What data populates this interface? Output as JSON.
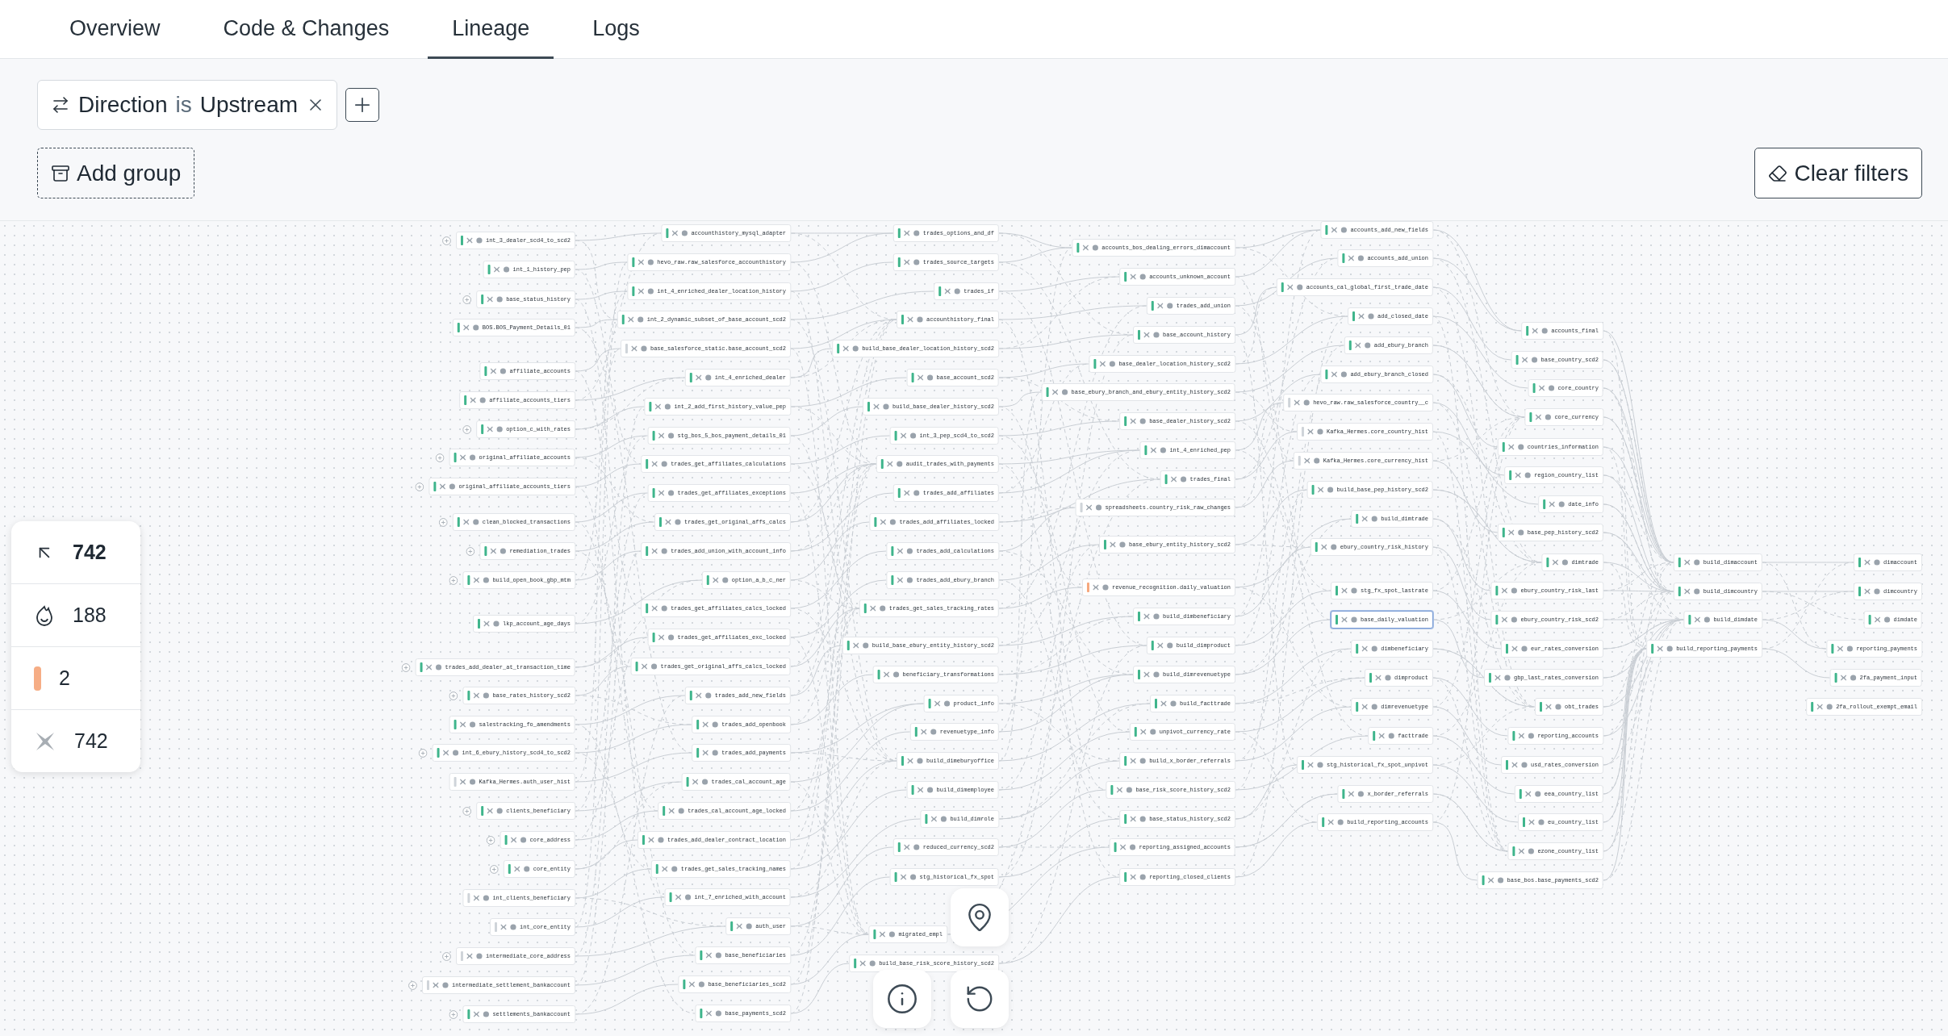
{
  "tabs": [
    {
      "label": "Overview",
      "selected": false
    },
    {
      "label": "Code & Changes",
      "selected": false
    },
    {
      "label": "Lineage",
      "selected": true
    },
    {
      "label": "Logs",
      "selected": false
    }
  ],
  "filters": [
    {
      "field": "Direction",
      "operator": "is",
      "value": "Upstream"
    }
  ],
  "add_group_button": "Add group",
  "clear_filters_button": "Clear filters",
  "stats": [
    {
      "kind": "upstream",
      "value": "742"
    },
    {
      "kind": "models",
      "value": "188"
    },
    {
      "kind": "warnings",
      "value": "2"
    },
    {
      "kind": "tests",
      "value": "742"
    }
  ],
  "lineage": {
    "columns": [
      [
        {
          "label": "int_3_dealer_scd4_to_scd2",
          "expandable": true,
          "color": "#3fb58c",
          "selected": false
        },
        {
          "label": "int_1_history_pep",
          "expandable": false,
          "color": "#3fb58c",
          "selected": false
        },
        {
          "label": "base_status_history",
          "expandable": true,
          "color": "#3fb58c",
          "selected": false
        },
        {
          "label": "BOS.BOS_Payment_Details_01",
          "expandable": false,
          "color": "#3fb58c",
          "selected": false
        },
        {
          "label": "affiliate_accounts",
          "expandable": false,
          "color": "#3fb58c",
          "selected": false
        },
        {
          "label": "affiliate_accounts_tiers",
          "expandable": false,
          "color": "#3fb58c",
          "selected": false
        },
        {
          "label": "option_c_with_rates",
          "expandable": true,
          "color": "#3fb58c",
          "selected": false
        },
        {
          "label": "original_affiliate_accounts",
          "expandable": true,
          "color": "#3fb58c",
          "selected": false
        },
        {
          "label": "original_affiliate_accounts_tiers",
          "expandable": true,
          "color": "#3fb58c",
          "selected": false
        },
        {
          "label": "clean_blocked_transactions",
          "expandable": true,
          "color": "#3fb58c",
          "selected": false
        },
        {
          "label": "remediation_trades",
          "expandable": true,
          "color": "#3fb58c",
          "selected": false
        },
        {
          "label": "build_open_book_gbp_mtm",
          "expandable": true,
          "color": "#3fb58c",
          "selected": false
        },
        {
          "label": "lkp_account_age_days",
          "expandable": false,
          "color": "#3fb58c",
          "selected": false
        },
        {
          "label": "trades_add_dealer_at_transaction_time",
          "expandable": true,
          "color": "#3fb58c",
          "selected": false
        },
        {
          "label": "base_rates_history_scd2",
          "expandable": true,
          "color": "#3fb58c",
          "selected": false
        },
        {
          "label": "salestracking_fo_amendments",
          "expandable": false,
          "color": "#3fb58c",
          "selected": false
        },
        {
          "label": "int_6_ebury_history_scd4_to_scd2",
          "expandable": true,
          "color": "#3fb58c",
          "selected": false
        },
        {
          "label": "Kafka_Hermes.auth_user_hist",
          "expandable": false,
          "color": "#cfd4d9",
          "selected": false
        },
        {
          "label": "clients_beneficiary",
          "expandable": true,
          "color": "#3fb58c",
          "selected": false
        },
        {
          "label": "core_address",
          "expandable": true,
          "color": "#3fb58c",
          "selected": false
        },
        {
          "label": "core_entity",
          "expandable": true,
          "color": "#3fb58c",
          "selected": false
        },
        {
          "label": "int_clients_beneficiary",
          "expandable": false,
          "color": "#cfd4d9",
          "selected": false
        },
        {
          "label": "int_core_entity",
          "expandable": false,
          "color": "#cfd4d9",
          "selected": false
        },
        {
          "label": "intermediate_core_address",
          "expandable": true,
          "color": "#cfd4d9",
          "selected": false
        },
        {
          "label": "intermediate_settlement_bankaccount",
          "expandable": true,
          "color": "#cfd4d9",
          "selected": false
        },
        {
          "label": "settlements_bankaccount",
          "expandable": true,
          "color": "#3fb58c",
          "selected": false
        }
      ],
      [
        {
          "label": "accounthistory_mysql_adapter",
          "expandable": false,
          "color": "#3fb58c",
          "selected": false
        },
        {
          "label": "hevo_raw.raw_salesforce_accounthistory",
          "expandable": false,
          "color": "#3fb58c",
          "selected": false
        },
        {
          "label": "int_4_enriched_dealer_location_history",
          "expandable": false,
          "color": "#3fb58c",
          "selected": false
        },
        {
          "label": "int_2_dynamic_subset_of_base_account_scd2",
          "expandable": false,
          "color": "#3fb58c",
          "selected": false
        },
        {
          "label": "base_salesforce_static.base_account_scd2",
          "expandable": false,
          "color": "#cfd4d9",
          "selected": false
        },
        {
          "label": "int_4_enriched_dealer",
          "expandable": false,
          "color": "#3fb58c",
          "selected": false
        },
        {
          "label": "int_2_add_first_history_value_pep",
          "expandable": false,
          "color": "#3fb58c",
          "selected": false
        },
        {
          "label": "stg_bos_5_bos_payment_details_01",
          "expandable": false,
          "color": "#3fb58c",
          "selected": false
        },
        {
          "label": "trades_get_affiliates_calculations",
          "expandable": false,
          "color": "#3fb58c",
          "selected": false
        },
        {
          "label": "trades_get_affiliates_exceptions",
          "expandable": false,
          "color": "#3fb58c",
          "selected": false
        },
        {
          "label": "trades_get_original_affs_calcs",
          "expandable": false,
          "color": "#3fb58c",
          "selected": false
        },
        {
          "label": "trades_add_union_with_account_info",
          "expandable": false,
          "color": "#3fb58c",
          "selected": false
        },
        {
          "label": "option_a_b_c_ner",
          "expandable": false,
          "color": "#3fb58c",
          "selected": false
        },
        {
          "label": "trades_get_affiliates_calcs_locked",
          "expandable": false,
          "color": "#3fb58c",
          "selected": false
        },
        {
          "label": "trades_get_affiliates_exc_locked",
          "expandable": false,
          "color": "#3fb58c",
          "selected": false
        },
        {
          "label": "trades_get_original_affs_calcs_locked",
          "expandable": false,
          "color": "#3fb58c",
          "selected": false
        },
        {
          "label": "trades_add_new_fields",
          "expandable": false,
          "color": "#3fb58c",
          "selected": false
        },
        {
          "label": "trades_add_openbook",
          "expandable": false,
          "color": "#3fb58c",
          "selected": false
        },
        {
          "label": "trades_add_payments",
          "expandable": false,
          "color": "#3fb58c",
          "selected": false
        },
        {
          "label": "trades_cal_account_age",
          "expandable": false,
          "color": "#3fb58c",
          "selected": false
        },
        {
          "label": "trades_cal_account_age_locked",
          "expandable": false,
          "color": "#3fb58c",
          "selected": false
        },
        {
          "label": "trades_add_dealer_contract_location",
          "expandable": false,
          "color": "#3fb58c",
          "selected": false
        },
        {
          "label": "trades_get_sales_tracking_names",
          "expandable": false,
          "color": "#3fb58c",
          "selected": false
        },
        {
          "label": "int_7_enriched_with_account",
          "expandable": false,
          "color": "#3fb58c",
          "selected": false
        },
        {
          "label": "auth_user",
          "expandable": false,
          "color": "#3fb58c",
          "selected": false
        },
        {
          "label": "base_beneficiaries",
          "expandable": false,
          "color": "#3fb58c",
          "selected": false
        },
        {
          "label": "base_beneficiaries_scd2",
          "expandable": false,
          "color": "#3fb58c",
          "selected": false
        },
        {
          "label": "base_payments_scd2",
          "expandable": false,
          "color": "#3fb58c",
          "selected": false
        }
      ],
      [
        {
          "label": "trades_options_and_df",
          "expandable": false,
          "color": "#3fb58c",
          "selected": false
        },
        {
          "label": "trades_source_targets",
          "expandable": false,
          "color": "#3fb58c",
          "selected": false
        },
        {
          "label": "trades_if",
          "expandable": false,
          "color": "#3fb58c",
          "selected": false
        },
        {
          "label": "accounthistory_final",
          "expandable": false,
          "color": "#3fb58c",
          "selected": false
        },
        {
          "label": "build_base_dealer_location_history_scd2",
          "expandable": false,
          "color": "#3fb58c",
          "selected": false
        },
        {
          "label": "base_account_scd2",
          "expandable": false,
          "color": "#3fb58c",
          "selected": false
        },
        {
          "label": "build_base_dealer_history_scd2",
          "expandable": false,
          "color": "#3fb58c",
          "selected": false
        },
        {
          "label": "int_3_pep_scd4_to_scd2",
          "expandable": false,
          "color": "#3fb58c",
          "selected": false
        },
        {
          "label": "audit_trades_with_payments",
          "expandable": false,
          "color": "#3fb58c",
          "selected": false
        },
        {
          "label": "trades_add_affiliates",
          "expandable": false,
          "color": "#3fb58c",
          "selected": false
        },
        {
          "label": "trades_add_affiliates_locked",
          "expandable": false,
          "color": "#3fb58c",
          "selected": false
        },
        {
          "label": "trades_add_calculations",
          "expandable": false,
          "color": "#3fb58c",
          "selected": false
        },
        {
          "label": "trades_add_ebury_branch",
          "expandable": false,
          "color": "#3fb58c",
          "selected": false
        },
        {
          "label": "trades_get_sales_tracking_rates",
          "expandable": false,
          "color": "#3fb58c",
          "selected": false
        },
        {
          "label": "build_base_ebury_entity_history_scd2",
          "expandable": false,
          "color": "#3fb58c",
          "selected": false
        },
        {
          "label": "beneficiary_transformations",
          "expandable": false,
          "color": "#3fb58c",
          "selected": false
        },
        {
          "label": "product_info",
          "expandable": false,
          "color": "#3fb58c",
          "selected": false
        },
        {
          "label": "revenuetype_info",
          "expandable": false,
          "color": "#3fb58c",
          "selected": false
        },
        {
          "label": "build_dimeburyoffice",
          "expandable": false,
          "color": "#3fb58c",
          "selected": false
        },
        {
          "label": "build_dimemployee",
          "expandable": false,
          "color": "#3fb58c",
          "selected": false
        },
        {
          "label": "build_dimrole",
          "expandable": false,
          "color": "#3fb58c",
          "selected": false
        },
        {
          "label": "reduced_currency_scd2",
          "expandable": false,
          "color": "#3fb58c",
          "selected": false
        },
        {
          "label": "stg_historical_fx_spot",
          "expandable": false,
          "color": "#3fb58c",
          "selected": false
        },
        {
          "label": "migrated_empl",
          "expandable": false,
          "color": "#3fb58c",
          "selected": false
        },
        {
          "label": "build_base_risk_score_history_scd2",
          "expandable": false,
          "color": "#3fb58c",
          "selected": false
        }
      ],
      [
        {
          "label": "accounts_bos_dealing_errors_dimaccount",
          "expandable": false,
          "color": "#3fb58c",
          "selected": false
        },
        {
          "label": "accounts_unknown_account",
          "expandable": false,
          "color": "#3fb58c",
          "selected": false
        },
        {
          "label": "trades_add_union",
          "expandable": false,
          "color": "#3fb58c",
          "selected": false
        },
        {
          "label": "base_account_history",
          "expandable": false,
          "color": "#3fb58c",
          "selected": false
        },
        {
          "label": "base_dealer_location_history_scd2",
          "expandable": false,
          "color": "#3fb58c",
          "selected": false
        },
        {
          "label": "base_ebury_branch_and_ebury_entity_history_scd2",
          "expandable": false,
          "color": "#3fb58c",
          "selected": false
        },
        {
          "label": "base_dealer_history_scd2",
          "expandable": false,
          "color": "#3fb58c",
          "selected": false
        },
        {
          "label": "int_4_enriched_pep",
          "expandable": false,
          "color": "#3fb58c",
          "selected": false
        },
        {
          "label": "trades_final",
          "expandable": false,
          "color": "#3fb58c",
          "selected": false
        },
        {
          "label": "spreadsheets.country_risk_raw_changes",
          "expandable": false,
          "color": "#cfd4d9",
          "selected": false
        },
        {
          "label": "base_ebury_entity_history_scd2",
          "expandable": false,
          "color": "#3fb58c",
          "selected": false
        },
        {
          "label": "revenue_recognition.daily_valuation",
          "expandable": false,
          "color": "#f6a77c",
          "selected": false
        },
        {
          "label": "build_dimbeneficiary",
          "expandable": false,
          "color": "#3fb58c",
          "selected": false
        },
        {
          "label": "build_dimproduct",
          "expandable": false,
          "color": "#3fb58c",
          "selected": false
        },
        {
          "label": "build_dimrevenuetype",
          "expandable": false,
          "color": "#3fb58c",
          "selected": false
        },
        {
          "label": "build_facttrade",
          "expandable": false,
          "color": "#3fb58c",
          "selected": false
        },
        {
          "label": "unpivot_currency_rate",
          "expandable": false,
          "color": "#3fb58c",
          "selected": false
        },
        {
          "label": "build_x_border_referrals",
          "expandable": false,
          "color": "#3fb58c",
          "selected": false
        },
        {
          "label": "base_risk_score_history_scd2",
          "expandable": false,
          "color": "#3fb58c",
          "selected": false
        },
        {
          "label": "base_status_history_scd2",
          "expandable": false,
          "color": "#3fb58c",
          "selected": false
        },
        {
          "label": "reporting_assigned_accounts",
          "expandable": false,
          "color": "#3fb58c",
          "selected": false
        },
        {
          "label": "reporting_closed_clients",
          "expandable": false,
          "color": "#3fb58c",
          "selected": false
        }
      ],
      [
        {
          "label": "accounts_add_new_fields",
          "expandable": false,
          "color": "#3fb58c",
          "selected": false
        },
        {
          "label": "accounts_add_union",
          "expandable": false,
          "color": "#3fb58c",
          "selected": false
        },
        {
          "label": "accounts_cal_global_first_trade_date",
          "expandable": false,
          "color": "#3fb58c",
          "selected": false
        },
        {
          "label": "add_closed_date",
          "expandable": false,
          "color": "#3fb58c",
          "selected": false
        },
        {
          "label": "add_ebury_branch",
          "expandable": false,
          "color": "#3fb58c",
          "selected": false
        },
        {
          "label": "add_ebury_branch_closed",
          "expandable": false,
          "color": "#3fb58c",
          "selected": false
        },
        {
          "label": "hevo_raw.raw_salesforce_country__c",
          "expandable": false,
          "color": "#cfd4d9",
          "selected": false
        },
        {
          "label": "Kafka_Hermes.core_country_hist",
          "expandable": false,
          "color": "#cfd4d9",
          "selected": false
        },
        {
          "label": "Kafka_Hermes.core_currency_hist",
          "expandable": false,
          "color": "#cfd4d9",
          "selected": false
        },
        {
          "label": "build_base_pep_history_scd2",
          "expandable": false,
          "color": "#3fb58c",
          "selected": false
        },
        {
          "label": "build_dimtrade",
          "expandable": false,
          "color": "#3fb58c",
          "selected": false
        },
        {
          "label": "ebury_country_risk_history",
          "expandable": false,
          "color": "#3fb58c",
          "selected": false
        },
        {
          "label": "stg_fx_spot_lastrate",
          "expandable": false,
          "color": "#3fb58c",
          "selected": false
        },
        {
          "label": "base_daily_valuation",
          "expandable": false,
          "color": "#3fb58c",
          "selected": true
        },
        {
          "label": "dimbeneficiary",
          "expandable": false,
          "color": "#3fb58c",
          "selected": false
        },
        {
          "label": "dimproduct",
          "expandable": false,
          "color": "#3fb58c",
          "selected": false
        },
        {
          "label": "dimrevenuetype",
          "expandable": false,
          "color": "#3fb58c",
          "selected": false
        },
        {
          "label": "facttrade",
          "expandable": false,
          "color": "#3fb58c",
          "selected": false
        },
        {
          "label": "stg_historical_fx_spot_unpivot",
          "expandable": false,
          "color": "#3fb58c",
          "selected": false
        },
        {
          "label": "x_border_referrals",
          "expandable": false,
          "color": "#3fb58c",
          "selected": false
        },
        {
          "label": "build_reporting_accounts",
          "expandable": false,
          "color": "#3fb58c",
          "selected": false
        }
      ],
      [
        {
          "label": "accounts_final",
          "expandable": false,
          "color": "#3fb58c",
          "selected": false
        },
        {
          "label": "base_country_scd2",
          "expandable": false,
          "color": "#3fb58c",
          "selected": false
        },
        {
          "label": "core_country",
          "expandable": false,
          "color": "#3fb58c",
          "selected": false
        },
        {
          "label": "core_currency",
          "expandable": false,
          "color": "#3fb58c",
          "selected": false
        },
        {
          "label": "countries_information",
          "expandable": false,
          "color": "#3fb58c",
          "selected": false
        },
        {
          "label": "region_country_list",
          "expandable": false,
          "color": "#3fb58c",
          "selected": false
        },
        {
          "label": "date_info",
          "expandable": false,
          "color": "#3fb58c",
          "selected": false
        },
        {
          "label": "base_pep_history_scd2",
          "expandable": false,
          "color": "#3fb58c",
          "selected": false
        },
        {
          "label": "dimtrade",
          "expandable": false,
          "color": "#3fb58c",
          "selected": false
        },
        {
          "label": "ebury_country_risk_last",
          "expandable": false,
          "color": "#3fb58c",
          "selected": false
        },
        {
          "label": "ebury_country_risk_scd2",
          "expandable": false,
          "color": "#3fb58c",
          "selected": false
        },
        {
          "label": "eur_rates_conversion",
          "expandable": false,
          "color": "#3fb58c",
          "selected": false
        },
        {
          "label": "gbp_last_rates_conversion",
          "expandable": false,
          "color": "#3fb58c",
          "selected": false
        },
        {
          "label": "obt_trades",
          "expandable": false,
          "color": "#3fb58c",
          "selected": false
        },
        {
          "label": "reporting_accounts",
          "expandable": false,
          "color": "#3fb58c",
          "selected": false
        },
        {
          "label": "usd_rates_conversion",
          "expandable": false,
          "color": "#3fb58c",
          "selected": false
        },
        {
          "label": "eea_country_list",
          "expandable": false,
          "color": "#3fb58c",
          "selected": false
        },
        {
          "label": "eu_country_list",
          "expandable": false,
          "color": "#3fb58c",
          "selected": false
        },
        {
          "label": "ezone_country_list",
          "expandable": false,
          "color": "#3fb58c",
          "selected": false
        },
        {
          "label": "base_bos.base_payments_scd2",
          "expandable": false,
          "color": "#3fb58c",
          "selected": false
        }
      ],
      [
        {
          "label": "build_dimaccount",
          "expandable": false,
          "color": "#3fb58c",
          "selected": false
        },
        {
          "label": "build_dimcountry",
          "expandable": false,
          "color": "#3fb58c",
          "selected": false
        },
        {
          "label": "build_dimdate",
          "expandable": false,
          "color": "#3fb58c",
          "selected": false
        },
        {
          "label": "build_reporting_payments",
          "expandable": false,
          "color": "#3fb58c",
          "selected": false
        }
      ],
      [
        {
          "label": "dimaccount",
          "expandable": false,
          "color": "#3fb58c",
          "selected": false
        },
        {
          "label": "dimcountry",
          "expandable": false,
          "color": "#3fb58c",
          "selected": false
        },
        {
          "label": "dimdate",
          "expandable": false,
          "color": "#3fb58c",
          "selected": false
        },
        {
          "label": "reporting_payments",
          "expandable": false,
          "color": "#3fb58c",
          "selected": false
        },
        {
          "label": "2fa_payment_input",
          "expandable": false,
          "color": "#3fb58c",
          "selected": false
        },
        {
          "label": "2fa_rollout_exempt_email",
          "expandable": false,
          "color": "#3fb58c",
          "selected": false
        }
      ]
    ]
  }
}
